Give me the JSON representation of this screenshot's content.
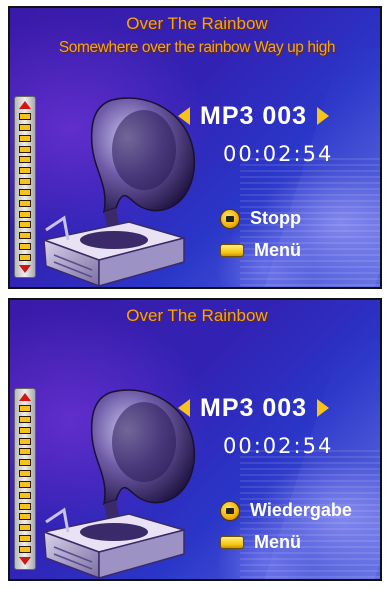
{
  "colors": {
    "title": "#f2a51a",
    "accent": "#f7c21a",
    "text": "#ffffff",
    "background": "#3222b4"
  },
  "screens": [
    {
      "title": "Over The Rainbow",
      "lyric": "Somewhere over the rainbow Way up high",
      "track": "MP3 003",
      "time": "00:02:54",
      "action_label": "Stopp",
      "menu_label": "Menü",
      "icons": {
        "action": "round-button-icon",
        "menu": "rect-button-icon",
        "art": "gramophone-icon"
      },
      "volume_segments": 14
    },
    {
      "title": "Over The Rainbow",
      "lyric": "",
      "track": "MP3 003",
      "time": "00:02:54",
      "action_label": "Wiedergabe",
      "menu_label": "Menü",
      "icons": {
        "action": "round-button-icon",
        "menu": "rect-button-icon",
        "art": "gramophone-icon"
      },
      "volume_segments": 14
    }
  ]
}
